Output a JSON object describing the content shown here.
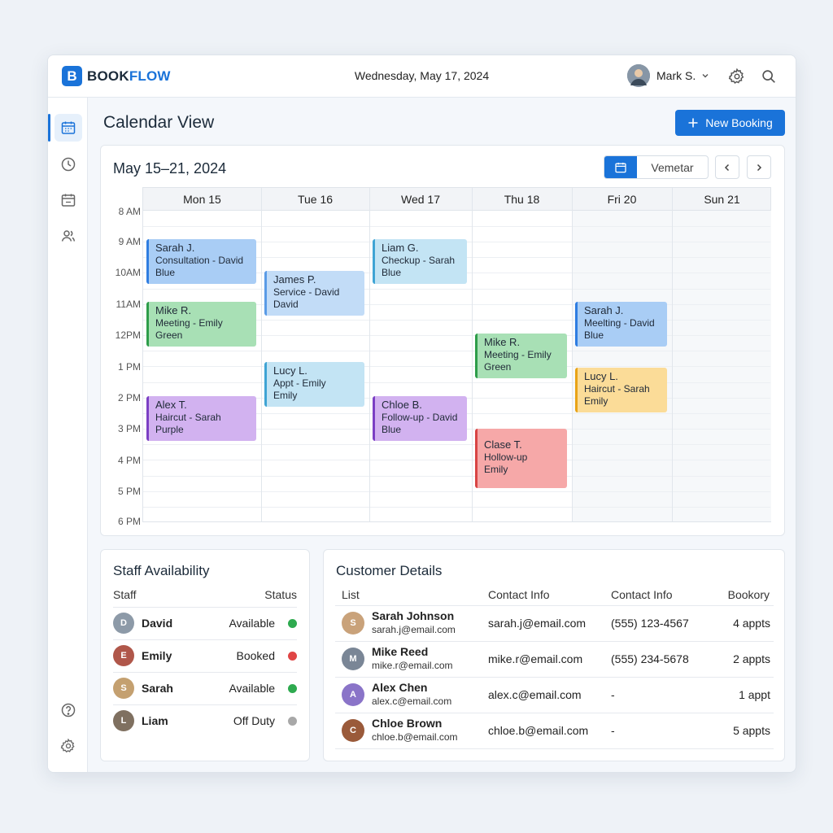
{
  "app": {
    "logo_letter": "B",
    "logo_part1": "BOOK",
    "logo_part2": "FLOW",
    "date": "Wednesday, May 17, 2024",
    "user_name": "Mark S."
  },
  "page": {
    "title": "Calendar View",
    "new_booking": "New Booking"
  },
  "calendar": {
    "range": "May 15–21, 2024",
    "view_label": "Vemetar",
    "days": [
      "Mon 15",
      "Tue 16",
      "Wed 17",
      "Thu 18",
      "Fri 20",
      "Sun 21"
    ],
    "times": [
      "8 AM",
      "9 AM",
      "10AM",
      "11AM",
      "12PM",
      "1 PM",
      "2 PM",
      "3 PM",
      "4 PM",
      "5 PM",
      "6 PM"
    ],
    "events": [
      {
        "name": "Sarah J.",
        "line1": "Consultation - David",
        "line2": "Blue",
        "color": "blue"
      },
      {
        "name": "Mike R.",
        "line1": "Meeting - Emily",
        "line2": "Green",
        "color": "green"
      },
      {
        "name": "Alex T.",
        "line1": "Haircut - Sarah",
        "line2": "Purple",
        "color": "purple"
      },
      {
        "name": "James P.",
        "line1": "Service - David",
        "line2": "David",
        "color": "lblue"
      },
      {
        "name": "Lucy L.",
        "line1": "Appt - Emily",
        "line2": "Emily",
        "color": "cyan"
      },
      {
        "name": "Liam G.",
        "line1": "Checkup - Sarah",
        "line2": "Blue",
        "color": "cyan"
      },
      {
        "name": "Chloe B.",
        "line1": "Follow-up - David",
        "line2": "Blue",
        "color": "purple"
      },
      {
        "name": "Mike R.",
        "line1": "Meeting - Emily",
        "line2": "Green",
        "color": "green"
      },
      {
        "name": "Clase T.",
        "line1": "Hollow-up",
        "line2": "Emily",
        "color": "red"
      },
      {
        "name": "Sarah J.",
        "line1": "Meelting - David",
        "line2": "Blue",
        "color": "blue"
      },
      {
        "name": "Lucy L.",
        "line1": "Haircut - Sarah",
        "line2": "Emily",
        "color": "yellow"
      }
    ]
  },
  "staff": {
    "title": "Staff Availability",
    "col_staff": "Staff",
    "col_status": "Status",
    "rows": [
      {
        "name": "David",
        "status": "Available",
        "dot": "#2eaa4f",
        "initial": "D",
        "av": "#8d9aa8"
      },
      {
        "name": "Emily",
        "status": "Booked",
        "dot": "#e04545",
        "initial": "E",
        "av": "#b0574a"
      },
      {
        "name": "Sarah",
        "status": "Available",
        "dot": "#2eaa4f",
        "initial": "S",
        "av": "#c4a070"
      },
      {
        "name": "Liam",
        "status": "Off Duty",
        "dot": "#a8a8a8",
        "initial": "L",
        "av": "#7f7060"
      }
    ]
  },
  "customers": {
    "title": "Customer Details",
    "col_list": "List",
    "col_contact1": "Contact Info",
    "col_contact2": "Contact Info",
    "col_bookings": "Bookory",
    "rows": [
      {
        "name": "Sarah Johnson",
        "email": "sarah.j@email.com",
        "contact": "sarah.j@email.com",
        "phone": "(555) 123-4567",
        "bookings": "4 appts",
        "initial": "S",
        "av": "#c9a27a"
      },
      {
        "name": "Mike Reed",
        "email": "mike.r@email.com",
        "contact": "mike.r@email.com",
        "phone": "(555) 234-5678",
        "bookings": "2 appts",
        "initial": "M",
        "av": "#7a8696"
      },
      {
        "name": "Alex Chen",
        "email": "alex.c@email.com",
        "contact": "alex.c@email.com",
        "phone": "-",
        "bookings": "1 appt",
        "initial": "A",
        "av": "#8a74c8"
      },
      {
        "name": "Chloe Brown",
        "email": "chloe.b@email.com",
        "contact": "chloe.b@email.com",
        "phone": "-",
        "bookings": "5 appts",
        "initial": "C",
        "av": "#9a5a3a"
      }
    ]
  },
  "colors": {
    "accent": "#1a73d9"
  }
}
